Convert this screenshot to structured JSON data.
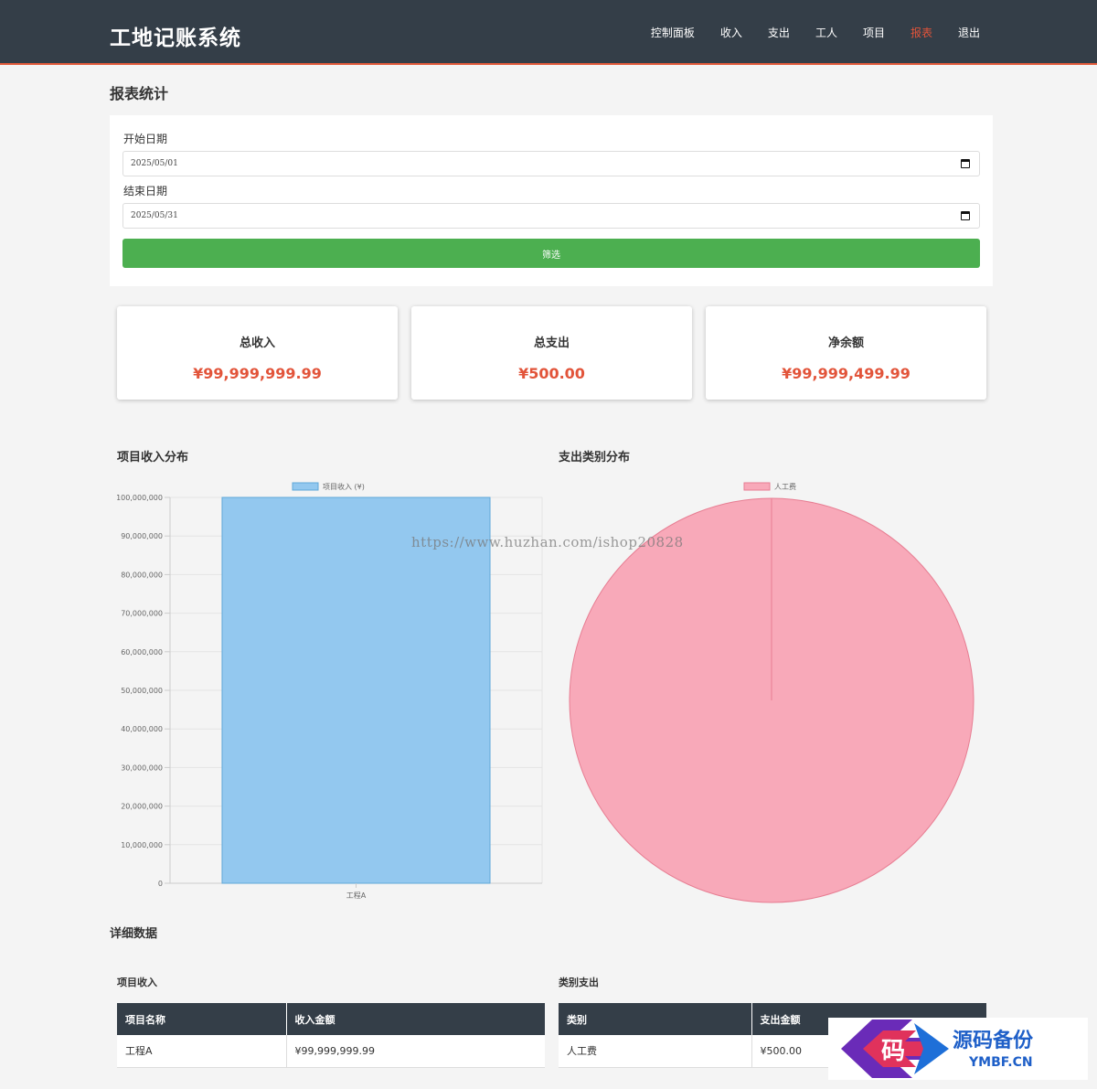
{
  "app": {
    "brand": "工地记账系统"
  },
  "nav": [
    {
      "label": "控制面板",
      "active": false
    },
    {
      "label": "收入",
      "active": false
    },
    {
      "label": "支出",
      "active": false
    },
    {
      "label": "工人",
      "active": false
    },
    {
      "label": "项目",
      "active": false
    },
    {
      "label": "报表",
      "active": true
    },
    {
      "label": "退出",
      "active": false
    }
  ],
  "page": {
    "title": "报表统计"
  },
  "filter": {
    "start_label": "开始日期",
    "start_value": "2025/05/01",
    "end_label": "结束日期",
    "end_value": "2025/05/31",
    "button_label": "筛选"
  },
  "stats": [
    {
      "title": "总收入",
      "value": "¥99,999,999.99"
    },
    {
      "title": "总支出",
      "value": "¥500.00"
    },
    {
      "title": "净余额",
      "value": "¥99,999,499.99"
    }
  ],
  "charts": {
    "income_title": "项目收入分布",
    "expense_title": "支出类别分布"
  },
  "chart_data": [
    {
      "type": "bar",
      "categories": [
        "工程A"
      ],
      "series": [
        {
          "name": "项目收入 (¥)",
          "values": [
            99999999.99
          ],
          "color": "#93c8ef",
          "border": "#5fa8d8"
        }
      ],
      "ylim": [
        0,
        100000000
      ],
      "yticks": [
        "0",
        "10,000,000",
        "20,000,000",
        "30,000,000",
        "40,000,000",
        "50,000,000",
        "60,000,000",
        "70,000,000",
        "80,000,000",
        "90,000,000",
        "100,000,000"
      ],
      "grid": true,
      "legend": "top"
    },
    {
      "type": "pie",
      "labels": [
        "人工费"
      ],
      "values": [
        500
      ],
      "colors": [
        "#f8a9b9"
      ],
      "border": "#e77d92",
      "legend": "top"
    }
  ],
  "watermark": "https://www.huzhan.com/ishop20828",
  "details": {
    "title": "详细数据",
    "income": {
      "title": "项目收入",
      "headers": [
        "项目名称",
        "收入金额"
      ],
      "rows": [
        [
          "工程A",
          "¥99,999,999.99"
        ]
      ]
    },
    "expense": {
      "title": "类别支出",
      "headers": [
        "类别",
        "支出金额"
      ],
      "rows": [
        [
          "人工费",
          "¥500.00"
        ]
      ]
    }
  },
  "badge": {
    "glyph": "码",
    "name": "源码备份",
    "domain": "YMBF.CN"
  }
}
